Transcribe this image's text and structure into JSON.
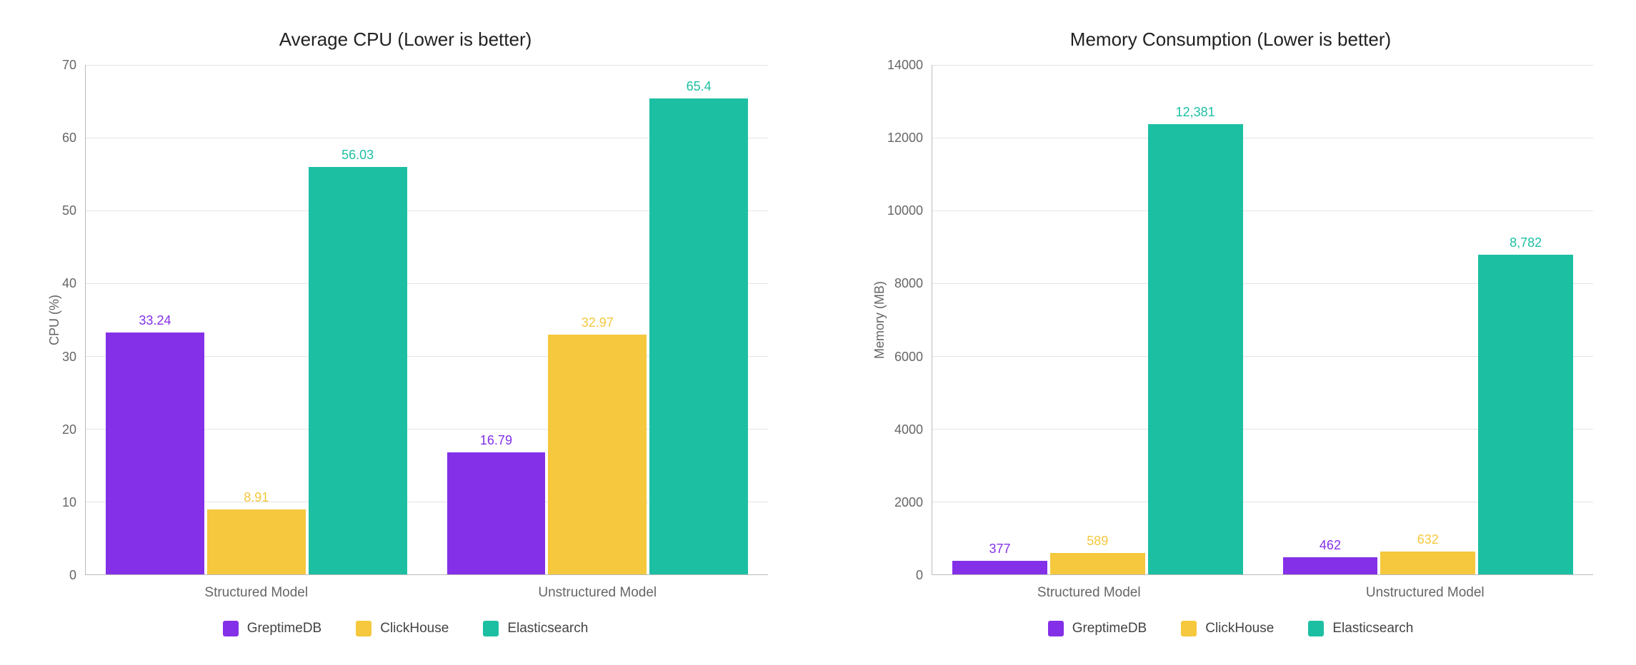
{
  "colors": {
    "GreptimeDB": "#8430E8",
    "ClickHouse": "#F5C83D",
    "Elasticsearch": "#1DBFA3"
  },
  "chart_data": [
    {
      "type": "bar",
      "title": "Average CPU (Lower is better)",
      "ylabel": "CPU (%)",
      "xlabel": "",
      "ylim": [
        0,
        70
      ],
      "ystep": 10,
      "categories": [
        "Structured Model",
        "Unstructured Model"
      ],
      "series": [
        {
          "name": "GreptimeDB",
          "values": [
            33.24,
            16.79
          ],
          "labels": [
            "33.24",
            "16.79"
          ]
        },
        {
          "name": "ClickHouse",
          "values": [
            8.91,
            32.97
          ],
          "labels": [
            "8.91",
            "32.97"
          ]
        },
        {
          "name": "Elasticsearch",
          "values": [
            56.03,
            65.4
          ],
          "labels": [
            "56.03",
            "65.4"
          ]
        }
      ]
    },
    {
      "type": "bar",
      "title": "Memory Consumption (Lower is better)",
      "ylabel": "Memory (MB)",
      "xlabel": "",
      "ylim": [
        0,
        14000
      ],
      "ystep": 2000,
      "categories": [
        "Structured Model",
        "Unstructured Model"
      ],
      "series": [
        {
          "name": "GreptimeDB",
          "values": [
            377,
            462
          ],
          "labels": [
            "377",
            "462"
          ]
        },
        {
          "name": "ClickHouse",
          "values": [
            589,
            632
          ],
          "labels": [
            "589",
            "632"
          ]
        },
        {
          "name": "Elasticsearch",
          "values": [
            12381,
            8782
          ],
          "labels": [
            "12,381",
            "8,782"
          ]
        }
      ]
    }
  ]
}
